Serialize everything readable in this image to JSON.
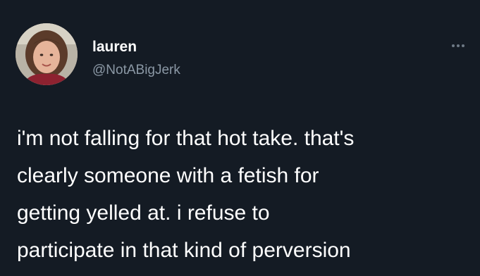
{
  "tweet": {
    "author": {
      "display_name": "lauren",
      "handle": "@NotABigJerk"
    },
    "text_lines": [
      "i'm not falling for that hot take. that's",
      "clearly someone with a fetish for",
      "getting yelled at. i refuse to",
      "participate in that kind of perversion"
    ],
    "more_icon": "ellipsis-icon"
  },
  "colors": {
    "background": "#141b24",
    "name": "#ffffff",
    "handle": "#8b98a5",
    "text": "#ffffff"
  }
}
